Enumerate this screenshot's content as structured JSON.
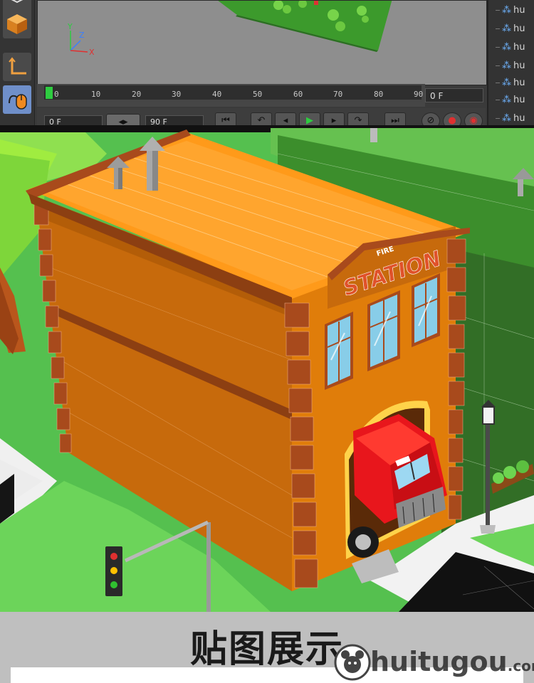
{
  "viewport": {
    "axis_labels": {
      "y": "Y",
      "z": "Z",
      "x": "X"
    }
  },
  "timeline": {
    "ticks": [
      "0",
      "10",
      "20",
      "30",
      "40",
      "50",
      "60",
      "70",
      "80",
      "90"
    ],
    "current_frame": "0 F"
  },
  "transport": {
    "start_field": "0 F",
    "end_field": "90 F"
  },
  "object_manager": {
    "items": [
      "hu",
      "hu",
      "hu",
      "hu",
      "hu",
      "hu",
      "hu"
    ]
  },
  "scene": {
    "sign_text": "STATION",
    "sign_top_text": "FIRE"
  },
  "footer": {
    "caption": "贴图展示",
    "watermark_brand": "huitugou",
    "watermark_domain": ".com"
  },
  "colors": {
    "ui_dark": "#3a3a3a",
    "viewport_gray": "#8e8e8e",
    "building_orange": "#e07d0a",
    "roof_orange": "#ff9a1a",
    "brick": "#a84a1c",
    "grass": "#55c04f",
    "truck_red": "#e8161c",
    "caption_bg": "#bfbfbf"
  },
  "icons": [
    "cube-icon",
    "axis-icon",
    "mouse-icon",
    "traffic-light",
    "street-lamp",
    "fire-truck"
  ]
}
